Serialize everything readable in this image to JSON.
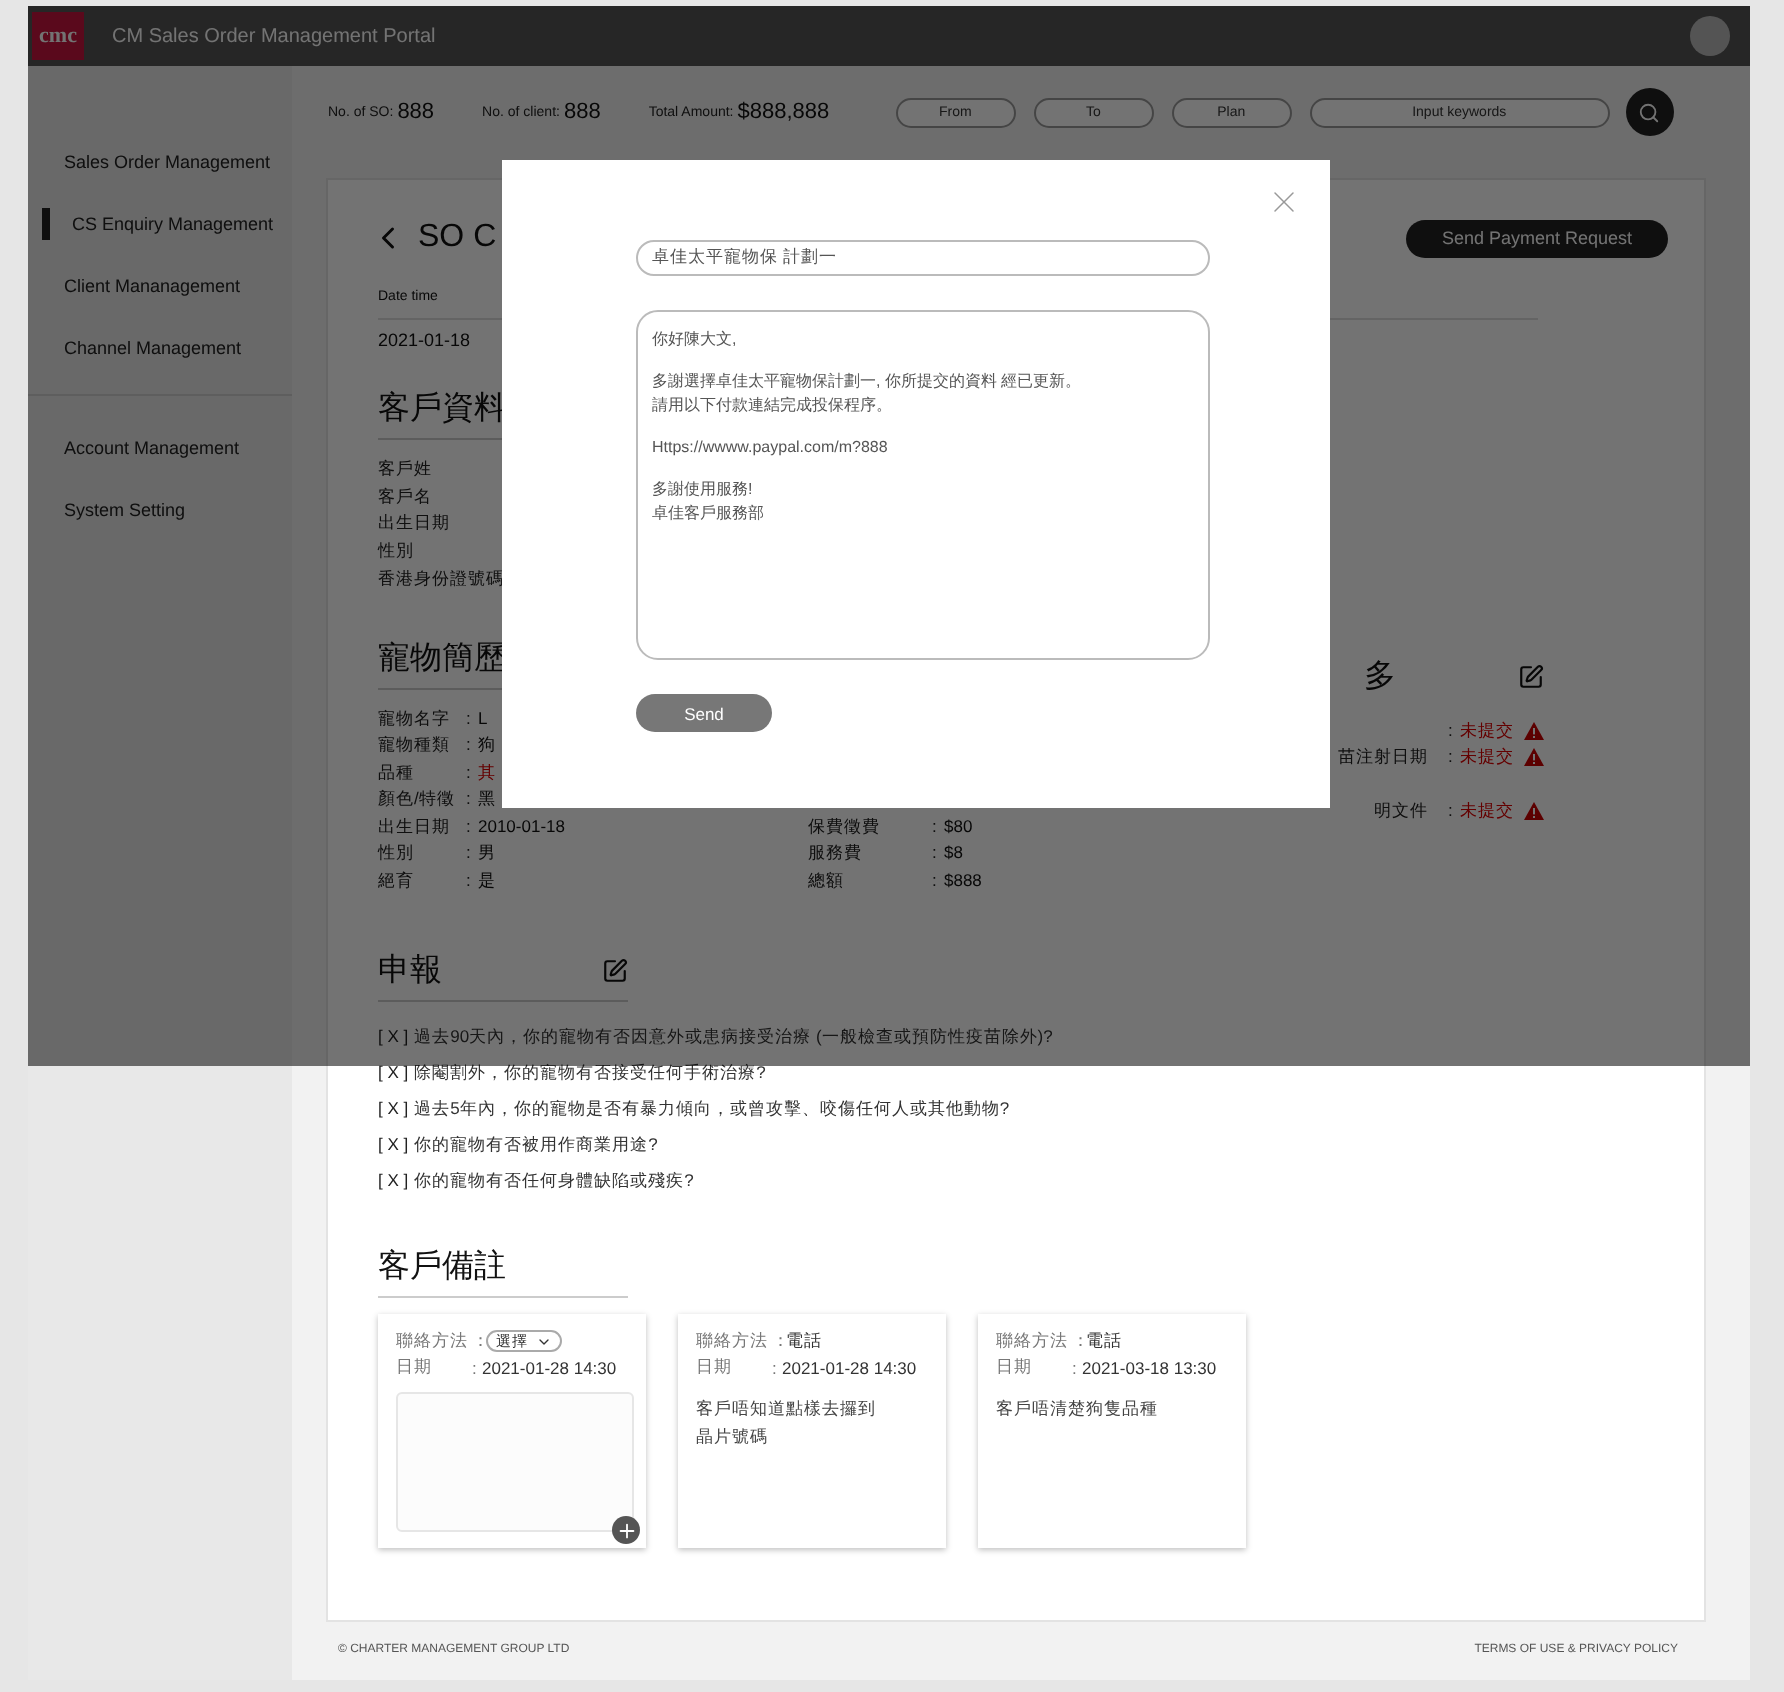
{
  "header": {
    "logo": "cmc",
    "title": "CM Sales Order Management Portal"
  },
  "sidebar": {
    "groups": [
      [
        {
          "label": "Sales Order Management",
          "selected": false
        },
        {
          "label": "CS Enquiry Management",
          "selected": true
        },
        {
          "label": "Client Mananagement",
          "selected": false
        },
        {
          "label": "Channel Management",
          "selected": false
        }
      ],
      [
        {
          "label": "Account Management",
          "selected": false
        },
        {
          "label": "System Setting",
          "selected": false
        }
      ]
    ]
  },
  "stats": [
    {
      "label": "No. of SO:",
      "value": "888"
    },
    {
      "label": "No. of client:",
      "value": "888"
    },
    {
      "label": "Total Amount:",
      "value": "$888,888"
    }
  ],
  "filters": [
    {
      "placeholder": "From"
    },
    {
      "placeholder": "To"
    },
    {
      "placeholder": "Plan"
    },
    {
      "placeholder": "Input keywords"
    }
  ],
  "order": {
    "title": "SO C",
    "action": "Send Payment Request",
    "date_label": "Date time",
    "date": "2021-01-18"
  },
  "client_section": {
    "title": "客戶資料",
    "fields": [
      "客戶姓",
      "客戶名",
      "出生日期",
      "性別",
      "香港身份證號碼"
    ]
  },
  "pet_section": {
    "title": "寵物簡歷",
    "fields": [
      {
        "label": "寵物名字",
        "colon": ":",
        "value": "L",
        "highlighted": false
      },
      {
        "label": "寵物種類",
        "colon": ":",
        "value": "狗",
        "highlighted": false
      },
      {
        "label": "品種",
        "colon": ":",
        "value": "其",
        "highlighted": true
      },
      {
        "label": "顏色/特徵",
        "colon": ":",
        "value": "黑",
        "highlighted": false
      },
      {
        "label": "出生日期",
        "colon": ":",
        "value": "2010-01-18",
        "highlighted": false
      },
      {
        "label": "性別",
        "colon": ":",
        "value": "男",
        "highlighted": false
      },
      {
        "label": "絕育",
        "colon": ":",
        "value": "是",
        "highlighted": false
      }
    ],
    "fees": [
      {
        "label": "保費徵費",
        "colon": ":",
        "value": "$80"
      },
      {
        "label": "服務費",
        "colon": ":",
        "value": "$8"
      },
      {
        "label": "總額",
        "colon": ":",
        "value": "$888"
      }
    ]
  },
  "documents": {
    "title": "多",
    "items": [
      {
        "colon": ":",
        "value": "未提交"
      },
      {
        "label": "苗注射日期",
        "colon": ":",
        "value": "未提交"
      },
      {
        "label": "明文件",
        "colon": ":",
        "value": "未提交"
      }
    ]
  },
  "declaration": {
    "title": "申報",
    "items": [
      {
        "answer": "[ X ]",
        "text": "過去90天內，你的寵物有否因意外或患病接受治療 (一般檢查或預防性疫苗除外)?"
      },
      {
        "answer": "[ X ]",
        "text": "除閹割外，你的寵物有否接受任何手術治療?"
      },
      {
        "answer": "[ X ]",
        "text": "過去5年內，你的寵物是否有暴力傾向，或曾攻擊、咬傷任何人或其他動物?"
      },
      {
        "answer": "[ X ]",
        "text": "你的寵物有否被用作商業用途?"
      },
      {
        "answer": "[ X ]",
        "text": "你的寵物有否任何身體缺陷或殘疾?"
      }
    ]
  },
  "notes": {
    "title": "客戶備註",
    "cards": [
      {
        "kind": "new",
        "method_label": "聯絡方法",
        "method_colon": "：",
        "method": "選擇",
        "date_label": "日期",
        "date_colon": ":",
        "date": "2021-01-28 14:30"
      },
      {
        "kind": "entry",
        "method_label": "聯絡方法",
        "method_colon": "：",
        "method": "電話",
        "date_label": "日期",
        "date_colon": ":",
        "date": "2021-01-28 14:30",
        "text": "客戶唔知道點樣去攞到晶片號碼"
      },
      {
        "kind": "entry",
        "method_label": "聯絡方法",
        "method_colon": "：",
        "method": "電話",
        "date_label": "日期",
        "date_colon": ":",
        "date": "2021-03-18 13:30",
        "text": "客戶唔清楚狗隻品種"
      }
    ]
  },
  "footer": {
    "copyright": "© CHARTER MANAGEMENT GROUP LTD",
    "links": "TERMS OF USE & PRIVACY POLICY"
  },
  "modal": {
    "subject": "卓佳太平寵物保 計劃一",
    "message": [
      [
        "你好陳大文,"
      ],
      [
        "多謝選擇卓佳太平寵物保計劃一, 你所提交的資料 經已更新。",
        "請用以下付款連結完成投保程序。"
      ],
      [
        "Https://wwww.paypal.com/m?888"
      ],
      [
        "多謝使用服務!",
        "卓佳客戶服務部"
      ]
    ],
    "send": "Send"
  }
}
